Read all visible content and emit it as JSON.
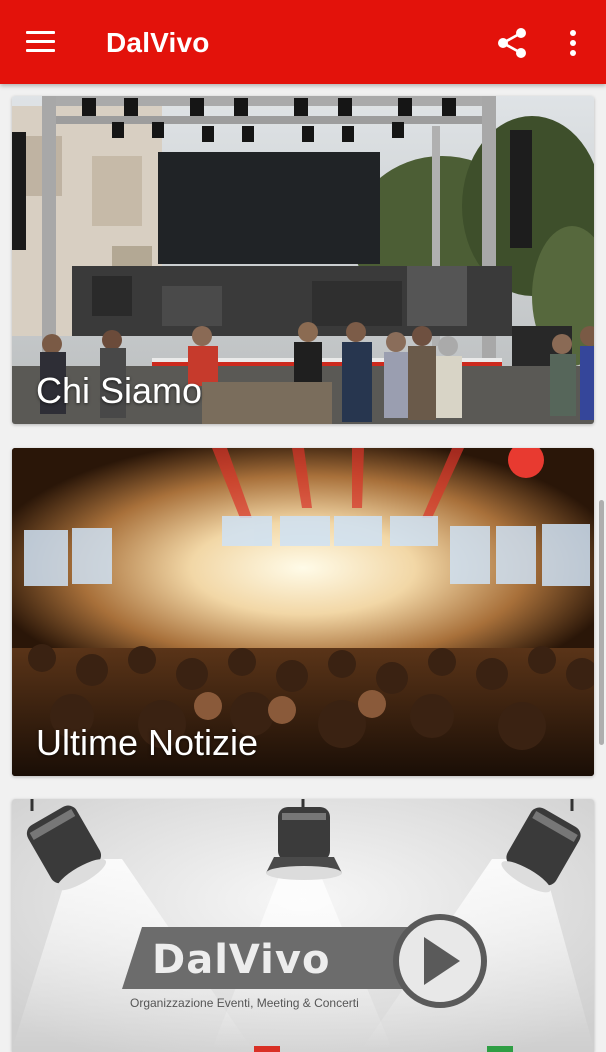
{
  "app": {
    "title": "DalVivo",
    "icons": {
      "menu": "menu-icon",
      "share": "share-icon",
      "more": "more-vert-icon"
    },
    "brand_color": "#e3120b"
  },
  "cards": [
    {
      "label": "Chi Siamo",
      "image": "outdoor concert stage setup with crowd"
    },
    {
      "label": "Ultime Notizie",
      "image": "concert crowd with bright stage lights"
    },
    {
      "logo_text": "DalVivo",
      "tagline": "Organizzazione Eventi, Meeting & Concerti",
      "image": "stage spotlights with DalVivo logo"
    }
  ]
}
